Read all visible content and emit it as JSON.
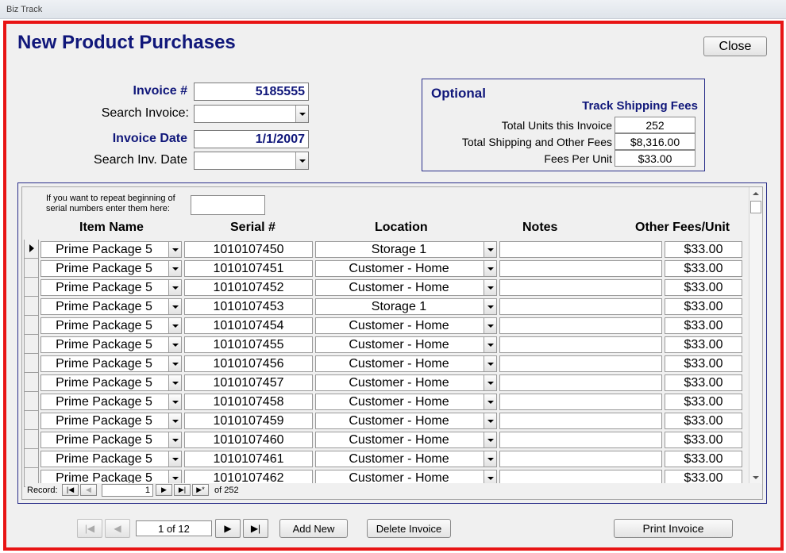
{
  "window": {
    "title": "Biz Track"
  },
  "form": {
    "title": "New Product Purchases",
    "close_label": "Close"
  },
  "header_fields": {
    "invoice_label": "Invoice #",
    "invoice_value": "5185555",
    "search_invoice_label": "Search Invoice:",
    "search_invoice_value": "",
    "invoice_date_label": "Invoice Date",
    "invoice_date_value": "1/1/2007",
    "search_date_label": "Search Inv. Date",
    "search_date_value": ""
  },
  "optional": {
    "title": "Optional",
    "subtitle": "Track Shipping Fees",
    "total_units_label": "Total Units this Invoice",
    "total_units_value": "252",
    "total_shipping_label": "Total Shipping and Other Fees",
    "total_shipping_value": "$8,316.00",
    "fees_per_unit_label": "Fees Per Unit",
    "fees_per_unit_value": "$33.00"
  },
  "subform": {
    "hint": "If you want to repeat beginning of serial numbers enter them here:",
    "hint_value": "",
    "columns": {
      "item_name": "Item Name",
      "serial": "Serial #",
      "location": "Location",
      "notes": "Notes",
      "other_fees": "Other Fees/Unit"
    },
    "rows": [
      {
        "item": "Prime Package 5",
        "serial": "1010107450",
        "location": "Storage 1",
        "notes": "",
        "fees": "$33.00"
      },
      {
        "item": "Prime Package 5",
        "serial": "1010107451",
        "location": "Customer - Home",
        "notes": "",
        "fees": "$33.00"
      },
      {
        "item": "Prime Package 5",
        "serial": "1010107452",
        "location": "Customer - Home",
        "notes": "",
        "fees": "$33.00"
      },
      {
        "item": "Prime Package 5",
        "serial": "1010107453",
        "location": "Storage 1",
        "notes": "",
        "fees": "$33.00"
      },
      {
        "item": "Prime Package 5",
        "serial": "1010107454",
        "location": "Customer - Home",
        "notes": "",
        "fees": "$33.00"
      },
      {
        "item": "Prime Package 5",
        "serial": "1010107455",
        "location": "Customer - Home",
        "notes": "",
        "fees": "$33.00"
      },
      {
        "item": "Prime Package 5",
        "serial": "1010107456",
        "location": "Customer - Home",
        "notes": "",
        "fees": "$33.00"
      },
      {
        "item": "Prime Package 5",
        "serial": "1010107457",
        "location": "Customer - Home",
        "notes": "",
        "fees": "$33.00"
      },
      {
        "item": "Prime Package 5",
        "serial": "1010107458",
        "location": "Customer - Home",
        "notes": "",
        "fees": "$33.00"
      },
      {
        "item": "Prime Package 5",
        "serial": "1010107459",
        "location": "Customer - Home",
        "notes": "",
        "fees": "$33.00"
      },
      {
        "item": "Prime Package 5",
        "serial": "1010107460",
        "location": "Customer - Home",
        "notes": "",
        "fees": "$33.00"
      },
      {
        "item": "Prime Package 5",
        "serial": "1010107461",
        "location": "Customer - Home",
        "notes": "",
        "fees": "$33.00"
      },
      {
        "item": "Prime Package 5",
        "serial": "1010107462",
        "location": "Customer - Home",
        "notes": "",
        "fees": "$33.00"
      }
    ],
    "record_nav": {
      "label": "Record:",
      "current": "1",
      "of_label": "of  252"
    }
  },
  "footer": {
    "page_indicator": "1 of 12",
    "add_new_label": "Add New",
    "delete_invoice_label": "Delete Invoice",
    "print_invoice_label": "Print Invoice"
  }
}
